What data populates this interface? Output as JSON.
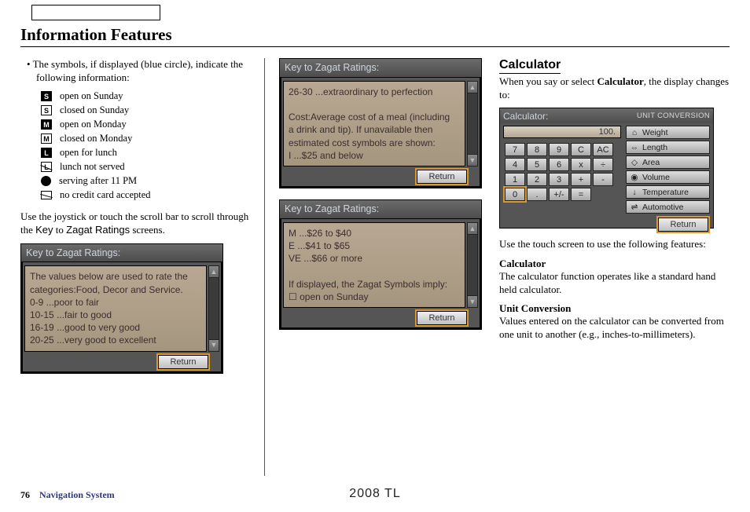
{
  "page_title": "Information Features",
  "col1": {
    "intro": "The symbols, if displayed (blue circle), indicate the following information:",
    "symbols": [
      {
        "glyph": "S",
        "style": "sym-s-filled",
        "label": "open on Sunday"
      },
      {
        "glyph": "S",
        "style": "sym-m-open",
        "label": "closed on Sunday"
      },
      {
        "glyph": "M",
        "style": "sym-m-filled",
        "label": "open on Monday"
      },
      {
        "glyph": "M",
        "style": "sym-m-open",
        "label": "closed on Monday"
      },
      {
        "glyph": "L",
        "style": "sym-l-filled",
        "label": "open for lunch"
      },
      {
        "glyph": "L",
        "style": "sym-m-open sym-l-slash",
        "label": "lunch not served"
      },
      {
        "glyph": "",
        "style": "sym-circle",
        "label": "serving after 11 PM"
      },
      {
        "glyph": "",
        "style": "sym-cc",
        "label": "no credit card accepted"
      }
    ],
    "para2a": "Use the joystick or touch the scroll bar to scroll through the ",
    "para2b": "Key",
    "para2c": " to ",
    "para2d": "Zagat Ratings",
    "para2e": " screens.",
    "screen1": {
      "title": "Key to Zagat Ratings:",
      "lines": [
        "The values below are used to rate the",
        "categories:Food, Decor and Service.",
        "0-9 ...poor to fair",
        "10-15 ...fair to good",
        "16-19 ...good to very good",
        "20-25 ...very good to excellent"
      ],
      "return": "Return"
    }
  },
  "col2": {
    "screen2": {
      "title": "Key to Zagat Ratings:",
      "lines": [
        "26-30 ...extraordinary to perfection",
        "",
        "Cost:Average cost of a meal (including",
        "a drink and tip). If unavailable then",
        "estimated cost symbols are shown:",
        "I ...$25 and below"
      ],
      "return": "Return"
    },
    "screen3": {
      "title": "Key to Zagat Ratings:",
      "lines": [
        "M ...$26 to $40",
        "E ...$41 to $65",
        "VE ...$66 or more",
        "",
        "If displayed, the Zagat Symbols imply:",
        "☐   open on Sunday"
      ],
      "return": "Return"
    }
  },
  "col3": {
    "heading": "Calculator",
    "intro_a": "When you say or select ",
    "intro_b": "Calculator",
    "intro_c": ", the display changes to:",
    "calc": {
      "title": "Calculator:",
      "uc_header": "UNIT CONVERSION",
      "display": "100.",
      "keys": [
        [
          "7",
          "8",
          "9",
          "C",
          "AC"
        ],
        [
          "4",
          "5",
          "6",
          "x",
          "÷"
        ],
        [
          "1",
          "2",
          "3",
          "+",
          "-"
        ],
        [
          "0",
          ".",
          "+/-",
          "=",
          ""
        ]
      ],
      "highlight_row": 3,
      "highlight_col": 0,
      "uc_items": [
        {
          "icon": "⌂",
          "label": "Weight"
        },
        {
          "icon": "⇔",
          "label": "Length"
        },
        {
          "icon": "◇",
          "label": "Area"
        },
        {
          "icon": "◉",
          "label": "Volume"
        },
        {
          "icon": "↓",
          "label": "Temperature"
        },
        {
          "icon": "⇌",
          "label": "Automotive"
        }
      ],
      "return": "Return"
    },
    "para2": "Use the touch screen to use the following features:",
    "h_calc": "Calculator",
    "p_calc": "The calculator function operates like a standard hand held calculator.",
    "h_uc": "Unit Conversion",
    "p_uc": "Values entered on the calculator can be converted from one unit to another (e.g., inches-to-millimeters)."
  },
  "footer": {
    "page": "76",
    "section": "Navigation System",
    "model": "2008  TL"
  }
}
